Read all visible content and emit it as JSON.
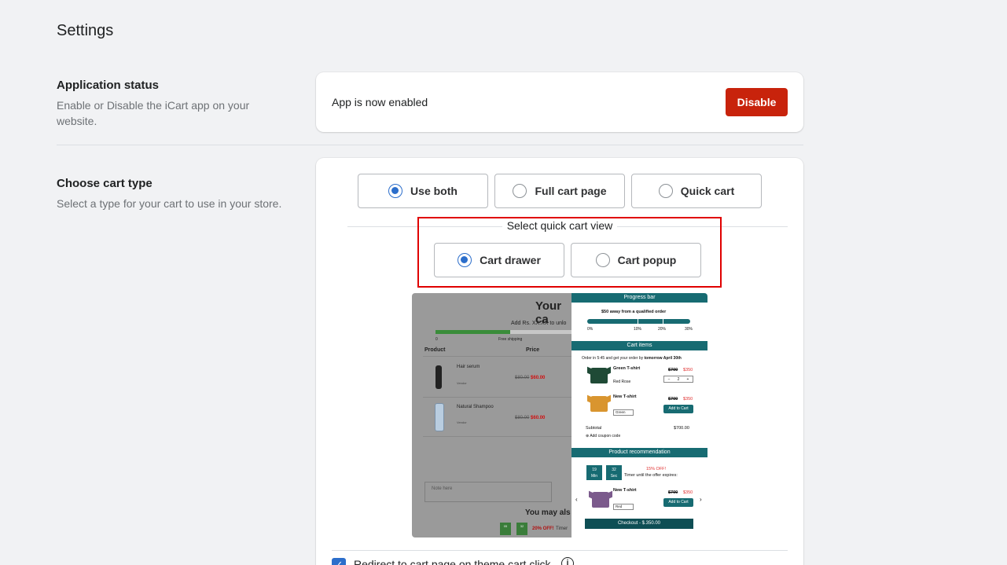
{
  "page": {
    "title": "Settings"
  },
  "app_status": {
    "title": "Application status",
    "description": "Enable or Disable the iCart app on your website.",
    "status_text": "App is now enabled",
    "button_label": "Disable"
  },
  "cart_type": {
    "title": "Choose cart type",
    "description": "Select a type for your cart to use in your store.",
    "options": [
      {
        "label": "Use both",
        "selected": true
      },
      {
        "label": "Full cart page",
        "selected": false
      },
      {
        "label": "Quick cart",
        "selected": false
      }
    ],
    "quick_view_label": "Select quick cart view",
    "quick_options": [
      {
        "label": "Cart drawer",
        "selected": true
      },
      {
        "label": "Cart popup",
        "selected": false
      }
    ],
    "redirect_label": "Redirect to cart page on theme cart click",
    "redirect_checked": true
  },
  "preview": {
    "left": {
      "title": "Your ca",
      "subtitle": "Add Rs. XX.XX to unlo",
      "tick_0": "0",
      "tick_free": "Free shipping",
      "col_product": "Product",
      "col_price": "Price",
      "item1_name": "Hair serum",
      "item1_vendor": "Vendor",
      "item1_old": "$80.00",
      "item1_new": "$60.00",
      "item2_name": "Natural Shampoo",
      "item2_vendor": "Vendor",
      "item2_old": "$80.00",
      "item2_new": "$60.00",
      "note": "Note here",
      "may_also": "You may als",
      "timer1": "05",
      "timer2": "32",
      "off": "20% OFF!",
      "timer_txt": "Timer"
    },
    "right": {
      "progress_head": "Progress bar",
      "progress_text": "$50 away from a qualified order",
      "ticks": [
        "0%",
        "10%",
        "20%",
        "30%"
      ],
      "items_head": "Cart items",
      "order_text": "Order in 5:45 and get your order by",
      "order_bold": "tomorrow April 30th",
      "item1_name": "Green T-shirt",
      "item1_old": "$700",
      "item1_new": "$350",
      "item1_variant": "Red Rose",
      "item1_qty": "2",
      "item2_name": "New T-shirt",
      "item2_old": "$700",
      "item2_new": "$350",
      "item2_select": "Green",
      "add_to_cart": "Add to Cart",
      "subtotal_label": "Subtotal",
      "subtotal_value": "$700.00",
      "coupon": "Add coupon code",
      "rec_head": "Product recommendation",
      "time_min_val": "19",
      "time_min_lbl": "Min",
      "time_sec_val": "32",
      "time_sec_lbl": "Sec",
      "rec_off": "15% OFF!",
      "rec_timer": "Timer until the offer expires:",
      "rec_name": "New T-shirt",
      "rec_old": "$700",
      "rec_new": "$350",
      "rec_select": "Red",
      "checkout": "Checkout - $.350.00"
    }
  },
  "colors": {
    "accent": "#2c6ecb",
    "danger": "#c8230c",
    "teal": "#176b72",
    "highlight": "#e00000"
  }
}
